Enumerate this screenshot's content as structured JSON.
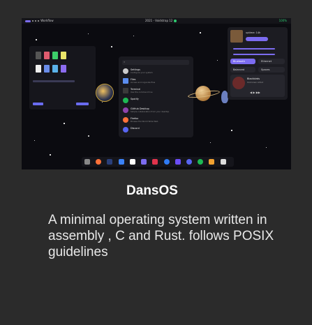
{
  "card": {
    "title": "DansOS",
    "description": "A minimal operating system written in assembly , C and Rust. follows POSIX guidelines"
  },
  "screenshot": {
    "topbar": {
      "workspace_label": "Workflow",
      "clock": "2021 - Voidstrap 12",
      "battery": "100%"
    },
    "launcher": {
      "apps": [
        {
          "name": "Settings",
          "desc": "Configure your system",
          "icon": "gear-icon",
          "color": "#cccccc"
        },
        {
          "name": "Files",
          "desc": "Access and organize files",
          "icon": "folder-icon",
          "color": "#5b8def"
        },
        {
          "name": "Terminal",
          "desc": "Use the command line",
          "icon": "terminal-icon",
          "color": "#3a3a3a"
        },
        {
          "name": "Spotify",
          "desc": "",
          "icon": "spotify-icon",
          "color": "#1db954"
        },
        {
          "name": "GitHub Desktop",
          "desc": "Simple collaboration from your desktop",
          "icon": "github-icon",
          "color": "#8e44ad"
        },
        {
          "name": "Firefox",
          "desc": "Browse the World Wide Web",
          "icon": "firefox-icon",
          "color": "#ff7139"
        },
        {
          "name": "Discord",
          "desc": "",
          "icon": "discord-icon",
          "color": "#5865f2"
        }
      ]
    },
    "quick_settings": {
      "uptime": "uptime: 14h",
      "toggle_1": "Bluetooth",
      "toggle_2": "Ethernet",
      "toggle_3": "Balanced",
      "toggle_4": "Spaces",
      "media_title": "Blackbirds",
      "media_artist": "Unknown Artist"
    }
  }
}
